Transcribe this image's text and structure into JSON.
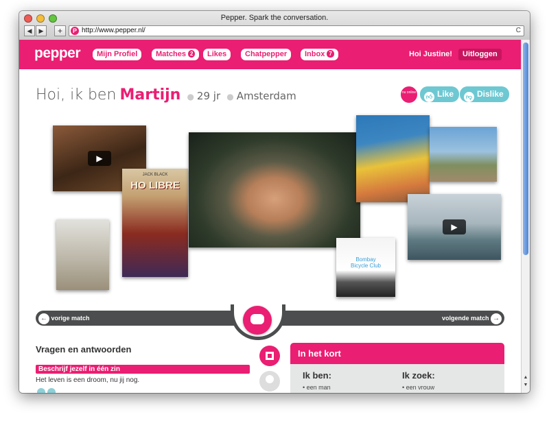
{
  "browser": {
    "title": "Pepper. Spark the conversation.",
    "url": "http://www.pepper.nl/",
    "back_glyph": "◀",
    "forward_glyph": "▶",
    "add_glyph": "+",
    "reload_glyph": "C",
    "favicon_letter": "P"
  },
  "nav": {
    "logo": "pepper",
    "items": [
      {
        "label": "Mijn Profiel",
        "count": null
      },
      {
        "label": "Matches",
        "count": "2"
      },
      {
        "label": "Likes",
        "count": null
      },
      {
        "label": "Chatpepper",
        "count": null
      },
      {
        "label": "Inbox",
        "count": "7"
      }
    ],
    "greeting": "Hoi Justine!",
    "logout": "Uitloggen"
  },
  "profile": {
    "intro": "Hoi, ik ben",
    "name": "Martijn",
    "age": "29 jr",
    "city": "Amsterdam",
    "online_badge": "nu online",
    "like": "Like",
    "dislike": "Dislike",
    "poster_text": "HO LIBRE",
    "poster_top": "JACK BLACK",
    "album_text": "Bombay Bicycle Club"
  },
  "match_nav": {
    "prev": "vorige match",
    "next": "volgende match",
    "prev_glyph": "←",
    "next_glyph": "→"
  },
  "qa": {
    "title": "Vragen en antwoorden",
    "question": "Beschrijf jezelf in één zin",
    "answer": "Het leven is een droom, nu jij nog."
  },
  "summary": {
    "title": "In het kort",
    "col1_title": "Ik ben:",
    "col1_value": "• een man",
    "col2_title": "Ik zoek:",
    "col2_value": "• een vrouw"
  },
  "colors": {
    "brand": "#ea1e72",
    "teal": "#6dc8d2",
    "dark": "#4b4d4e"
  },
  "icons": [
    "play-icon",
    "like-icon",
    "dislike-icon",
    "chat-icon",
    "arrow-left-icon",
    "arrow-right-icon",
    "user-icon"
  ]
}
